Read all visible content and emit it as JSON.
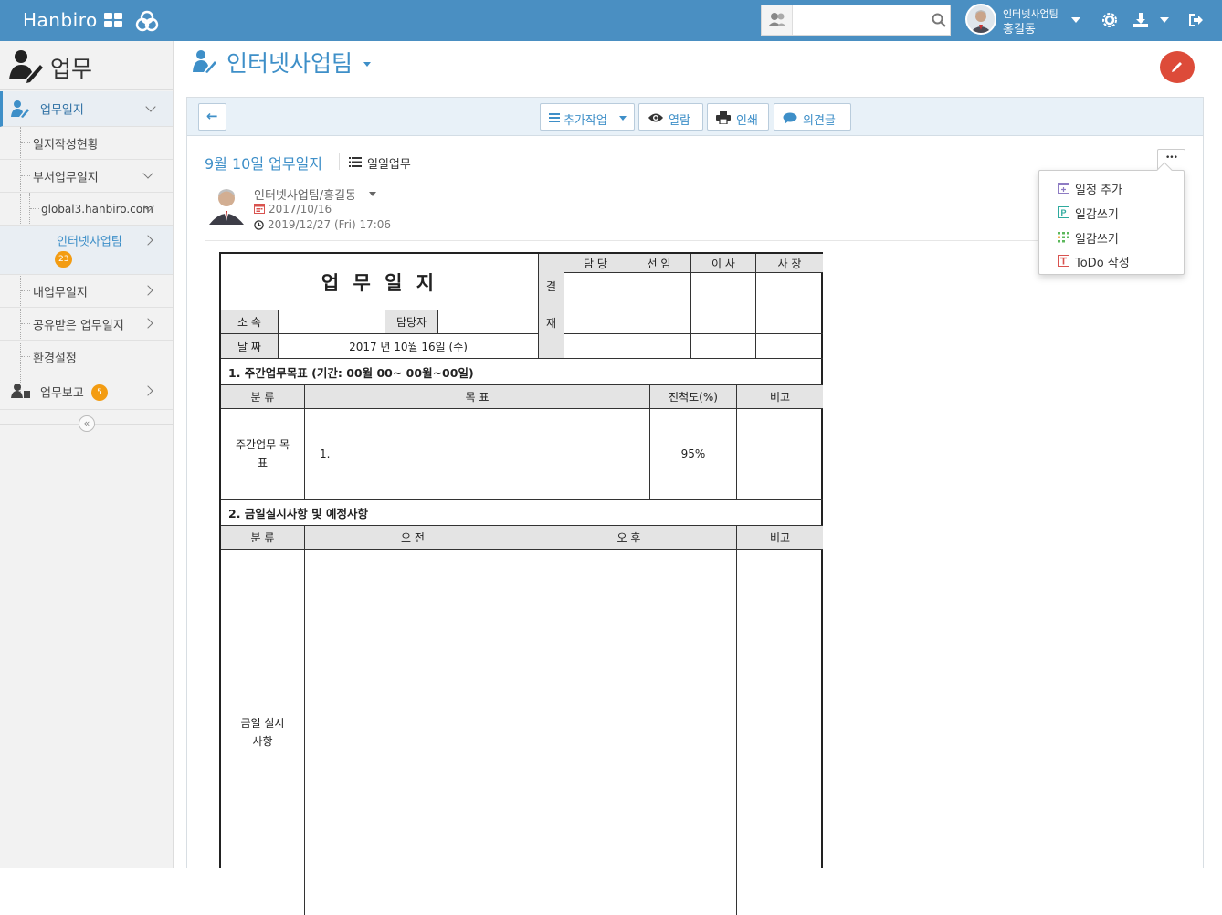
{
  "topbar": {
    "logo": "Hanbiro",
    "search_placeholder": "",
    "user_team": "인터넷사업팀",
    "user_name": "홍길동"
  },
  "sidebar": {
    "title": "업무",
    "items": [
      {
        "label": "업무일지"
      },
      {
        "label": "일지작성현황"
      },
      {
        "label": "부서업무일지"
      },
      {
        "label": "global3.hanbiro.com"
      },
      {
        "label": "인터넷사업팀",
        "badge": "23"
      },
      {
        "label": "내업무일지"
      },
      {
        "label": "공유받은 업무일지"
      },
      {
        "label": "환경설정"
      },
      {
        "label": "업무보고",
        "badge": "5"
      }
    ],
    "collapse_glyph": "«"
  },
  "main": {
    "title": "인터넷사업팀",
    "toolbar": {
      "back_glyph": "←",
      "extra_work": "추가작업",
      "view": "열람",
      "print": "인쇄",
      "comment": "의견글"
    },
    "diary": {
      "title": "9월 10일 업무일지",
      "type": "일일업무",
      "author": "인터넷사업팀/홍길동",
      "date": "2017/10/16",
      "datetime": "2019/12/27 (Fri) 17:06"
    },
    "menu": {
      "dots": "•••",
      "items": [
        "일정 추가",
        "일감쓰기",
        "일감쓰기",
        "ToDo 작성"
      ]
    }
  },
  "doc": {
    "title": "업 무 일 지",
    "approval": {
      "label_top": "결",
      "label_bottom": "재",
      "roles": [
        "담 당",
        "선 임",
        "이 사",
        "사 장"
      ]
    },
    "dept_label": "소 속",
    "dept_value": "",
    "manager_label": "담당자",
    "manager_value": "",
    "date_label": "날 짜",
    "date_value": "2017 년 10월 16일 (수)",
    "section1": {
      "heading": "1. 주간업무목표 (기간: 00월 00~ 00월~00일)",
      "headers": [
        "분 류",
        "목 표",
        "진척도(%)",
        "비고"
      ],
      "row": {
        "category": "주간업무 목표",
        "goal": "1.",
        "progress": "95%",
        "note": ""
      }
    },
    "section2": {
      "heading": "2. 금일실시사항 및 예정사항",
      "headers": [
        "분 류",
        "오 전",
        "오 후",
        "비고"
      ],
      "row": {
        "category": "금일 실시사항"
      }
    }
  },
  "colors": {
    "topbar": "#4a8fc2",
    "accent_blue": "#3e8fc8",
    "badge_orange": "#f39c12",
    "fab_red": "#dd4b39"
  },
  "icons": [
    "grid-icon",
    "circles-logo-icon",
    "people-icon",
    "search-icon",
    "user-avatar",
    "caret-down-icon",
    "gear-icon",
    "download-icon",
    "logout-icon",
    "work-icon",
    "arrow-left-icon",
    "list-icon",
    "eye-icon",
    "print-icon",
    "comment-icon",
    "calendar-icon",
    "clock-icon",
    "pencil-icon",
    "more-icon"
  ]
}
